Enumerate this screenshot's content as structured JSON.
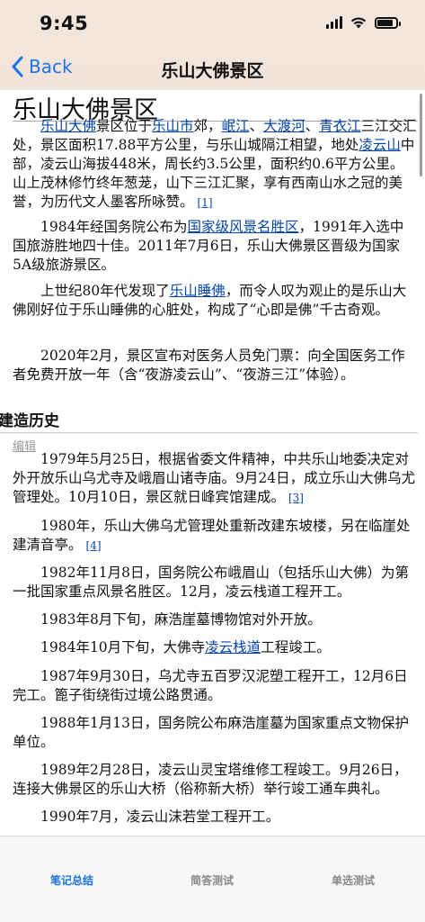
{
  "status": {
    "time": "9:45",
    "battery_level": 0.85
  },
  "nav": {
    "back_label": "Back",
    "title": "乐山大佛景区"
  },
  "article": {
    "title": "乐山大佛景区",
    "p1": {
      "link_dafo": "乐山大佛",
      "t1": "景区位于",
      "link_city": "乐山市",
      "t2": "郊，",
      "link_min": "岷江",
      "sep1": "、",
      "link_dadu": "大渡河",
      "sep2": "、",
      "link_qingyi": "青衣江",
      "t3": "三江交汇处，景区面积17.88平方公里，与乐山城隔江相望，地处",
      "link_lingyun": "凌云山",
      "t4": "中部，凌云山海拔448米，周长约3.5公里，面积约0.6平方公里。山上茂林修竹终年葱茏，山下三江汇聚，享有西南山水之冠的美誉，为历代文人墨客所咏赞。",
      "ref": "[1]"
    },
    "p2": {
      "t1": "1984年经国务院公布为",
      "link": "国家级风景名胜区",
      "t2": "，1991年入选中国旅游胜地四十佳。2011年7月6日，乐山大佛景区晋级为国家5A级旅游景区。"
    },
    "p3": {
      "t1": "上世纪80年代发现了",
      "link": "乐山睡佛",
      "t2": "，而令人叹为观止的是乐山大佛刚好位于乐山睡佛的心脏处，构成了“心即是佛”千古奇观。"
    },
    "p4": "2020年2月，景区宣布对医务人员免门票：向全国医务工作者免费开放一年（含“夜游凌云山”、“夜游三江”体验）。",
    "section_title": "建造历史",
    "edit_label": "编辑",
    "h1": {
      "text": "1979年5月25日，根据省委文件精神，中共乐山地委决定对外开放乐山乌尤寺及峨眉山诸寺庙。9月24日，成立乐山大佛乌尤管理处。10月10日，景区就日峰宾馆建成。",
      "ref": "[3]"
    },
    "h2": {
      "text": "1980年，乐山大佛乌尤管理处重新改建东坡楼，另在临崖处建清音亭。",
      "ref": "[4]"
    },
    "h3": "1982年11月8日，国务院公布峨眉山（包括乐山大佛）为第一批国家重点风景名胜区。12月，凌云栈道工程开工。",
    "h4": "1983年8月下旬，麻浩崖墓博物馆对外开放。",
    "h5": {
      "t1": "1984年10月下旬，大佛寺",
      "link": "凌云栈道",
      "t2": "工程竣工。"
    },
    "h6": "1987年9月30日，乌尤寺五百罗汉泥塑工程开工，12月6日完工。篦子街绕街过境公路贯通。",
    "h7": "1988年1月13日，国务院公布麻浩崖墓为国家重点文物保护单位。",
    "h8": "1989年2月28日，凌云山灵宝塔维修工程竣工。9月26日，连接大佛景区的乐山大桥（俗称新大桥）举行竣工通车典礼。",
    "h9": "1990年7月，凌云山沫若堂工程开工。"
  },
  "tabs": {
    "notes": "笔记总结",
    "short": "简答测试",
    "choice": "单选测试"
  }
}
